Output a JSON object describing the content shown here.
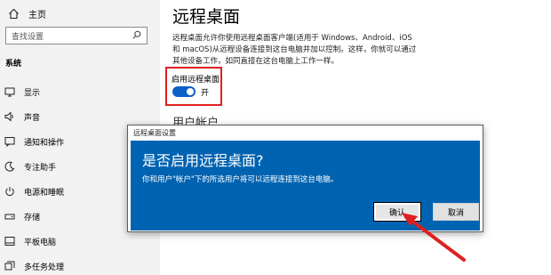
{
  "sidebar": {
    "home_label": "主页",
    "search_placeholder": "查找设置",
    "section": "系统",
    "items": [
      {
        "label": "显示",
        "icon": "monitor-icon"
      },
      {
        "label": "声音",
        "icon": "speaker-icon"
      },
      {
        "label": "通知和操作",
        "icon": "notification-icon"
      },
      {
        "label": "专注助手",
        "icon": "moon-icon"
      },
      {
        "label": "电源和睡眠",
        "icon": "power-icon"
      },
      {
        "label": "存储",
        "icon": "storage-icon"
      },
      {
        "label": "平板电脑",
        "icon": "tablet-icon"
      },
      {
        "label": "多任务处理",
        "icon": "multitask-icon"
      }
    ]
  },
  "main": {
    "title": "远程桌面",
    "description_line1": "远程桌面允许你使用远程桌面客户端(适用于 Windows、Android、iOS",
    "description_line2": "和 macOS)从远程设备连接到这台电脑并加以控制。这样，你就可以通过",
    "description_line3": "其他设备工作，如同直接在这台电脑上工作一样。",
    "toggle_label": "启用远程桌面",
    "toggle_state": "开",
    "toggle_on": true,
    "user_accounts_heading": "用户帐户"
  },
  "dialog": {
    "title": "远程桌面设置",
    "heading": "是否启用远程桌面?",
    "message": "你和用户\"帐户\"下的所选用户将可以远程连接到这台电脑。",
    "ok_label": "确认",
    "cancel_label": "取消"
  },
  "colors": {
    "accent": "#0063b1",
    "toggle_on": "#0b60c8",
    "highlight": "#e02020",
    "sidebar_bg": "#f2f2f2"
  }
}
